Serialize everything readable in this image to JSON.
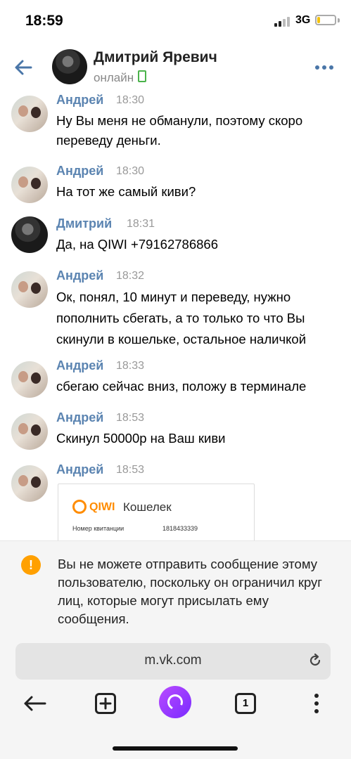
{
  "status_bar": {
    "time": "18:59",
    "network": "3G"
  },
  "header": {
    "name": "Дмитрий Яревич",
    "status": "онлайн"
  },
  "messages": [
    {
      "author": "Андрей",
      "time": "18:30",
      "text": "Ну Вы меня не обманули, поэтому скоро переведу деньги."
    },
    {
      "author": "Андрей",
      "time": "18:30",
      "text": "На тот же самый киви?"
    },
    {
      "author": "Дмитрий",
      "time": "18:31",
      "text": "Да, на QIWI +79162786866"
    },
    {
      "author": "Андрей",
      "time": "18:32",
      "text": "Ок, понял, 10 минут и переведу, нужно пополнить сбегать, а то только то что Вы скинули в кошельке, остальное наличкой"
    },
    {
      "author": "Андрей",
      "time": "18:33",
      "text": "сбегаю сейчас вниз, положу в терминале"
    },
    {
      "author": "Андрей",
      "time": "18:53",
      "text": "Скинул 50000р на Ваш киви"
    },
    {
      "author": "Андрей",
      "time": "18:53",
      "text": ""
    }
  ],
  "attachment": {
    "brand": "QIWI",
    "title": "Кошелек",
    "receipt_label": "Номер квитанции",
    "receipt_value": "1818433339"
  },
  "notice": {
    "text": "Вы не можете отправить сообщение этому пользователю, поскольку он ограничил круг лиц, которые могут присылать ему сообщения."
  },
  "browser": {
    "url": "m.vk.com",
    "tab_count": "1"
  },
  "colors": {
    "accent": "#4a76a8",
    "author": "#5b84b1",
    "warning": "#ffa000",
    "online": "#4bb34b",
    "qiwi": "#ff8c00",
    "alice": "#8a3bff"
  }
}
